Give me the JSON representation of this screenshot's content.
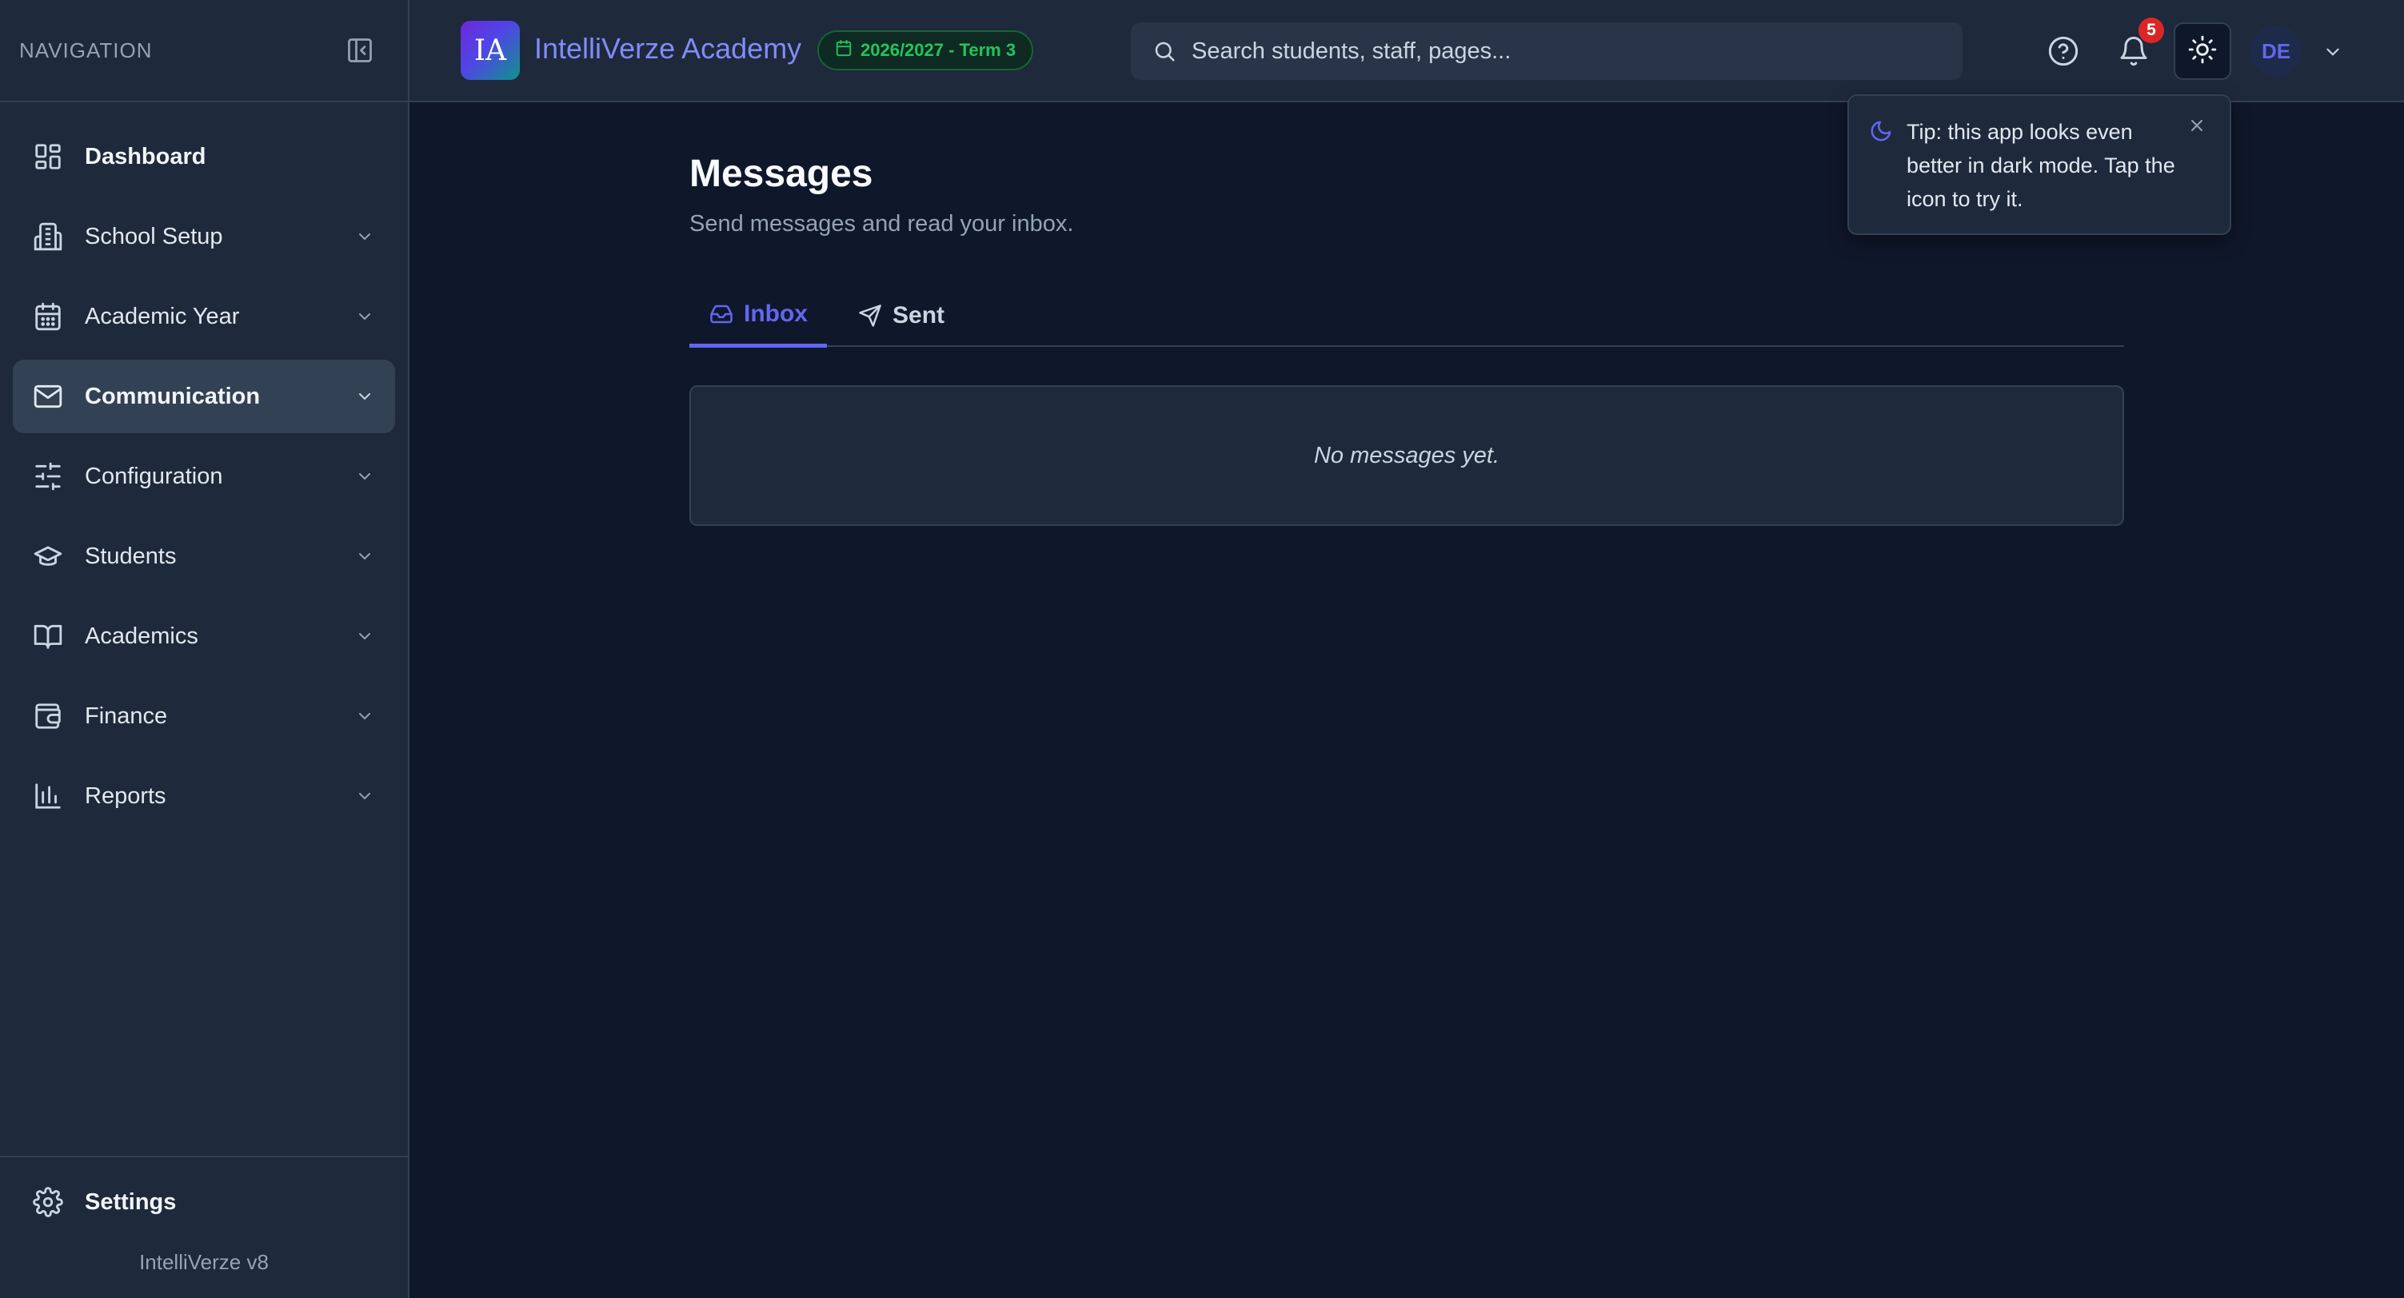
{
  "sidebar": {
    "title": "NAVIGATION",
    "items": [
      {
        "label": "Dashboard",
        "icon": "dashboard-icon"
      },
      {
        "label": "School Setup",
        "icon": "building-icon"
      },
      {
        "label": "Academic Year",
        "icon": "calendar-icon"
      },
      {
        "label": "Communication",
        "icon": "mail-icon"
      },
      {
        "label": "Configuration",
        "icon": "sliders-icon"
      },
      {
        "label": "Students",
        "icon": "graduation-cap-icon"
      },
      {
        "label": "Academics",
        "icon": "book-icon"
      },
      {
        "label": "Finance",
        "icon": "wallet-icon"
      },
      {
        "label": "Reports",
        "icon": "bar-chart-icon"
      }
    ],
    "settings_label": "Settings",
    "version": "IntelliVerze v8"
  },
  "topbar": {
    "logo_text": "IA",
    "app_name": "IntelliVerze Academy",
    "term": "2026/2027 - Term 3",
    "search_placeholder": "Search students, staff, pages...",
    "notification_count": "5",
    "avatar_initials": "DE"
  },
  "tip": {
    "text": "Tip: this app looks even better in dark mode. Tap the icon to try it."
  },
  "main": {
    "title": "Messages",
    "subtitle": "Send messages and read your inbox.",
    "tabs": [
      {
        "label": "Inbox",
        "active": true
      },
      {
        "label": "Sent",
        "active": false
      }
    ],
    "empty_text": "No messages yet."
  },
  "colors": {
    "accent": "#6366f1",
    "background": "#0f172a",
    "panel": "#1e293b",
    "term_green": "#22c55e",
    "badge_red": "#dc2626"
  }
}
